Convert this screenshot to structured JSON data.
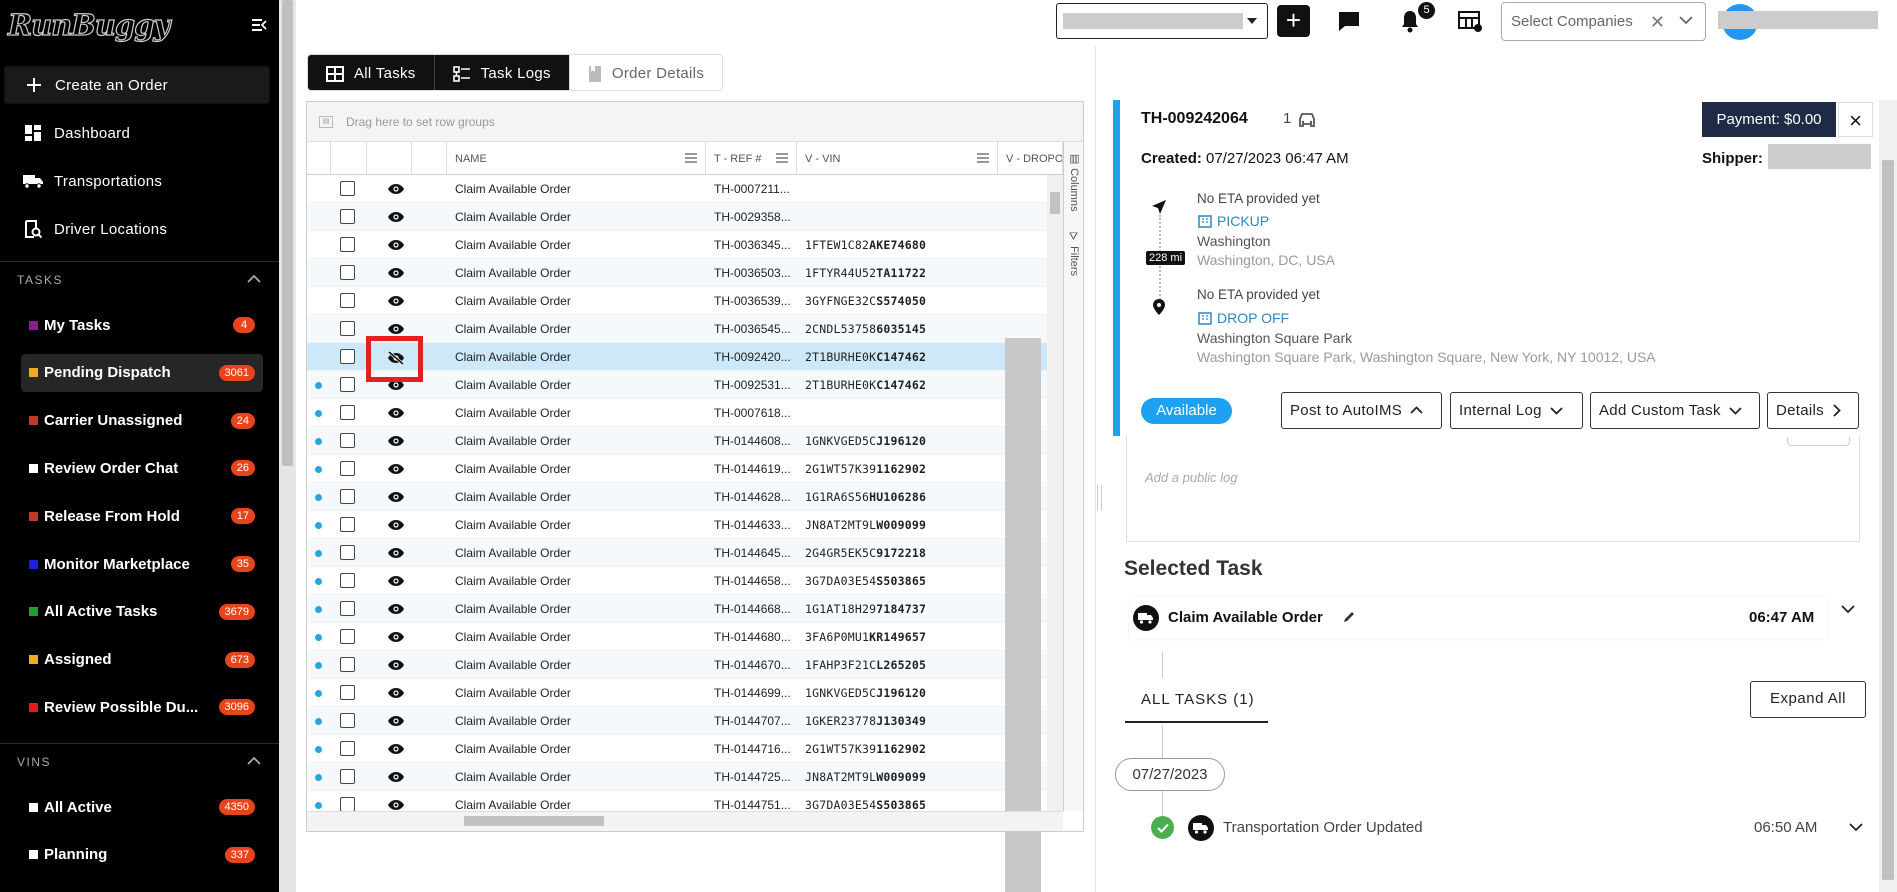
{
  "app": {
    "logo": "RunBuggy"
  },
  "sidebar": {
    "nav": [
      {
        "label": "Create an Order",
        "icon": "plus-icon"
      },
      {
        "label": "Dashboard",
        "icon": "dashboard-icon"
      },
      {
        "label": "Transportations",
        "icon": "truck-icon"
      },
      {
        "label": "Driver Locations",
        "icon": "map-search-icon"
      }
    ],
    "tasks_section": "TASKS",
    "tasks": [
      {
        "label": "My Tasks",
        "count": "4",
        "color": "#8b1e8b"
      },
      {
        "label": "Pending Dispatch",
        "count": "3061",
        "color": "#f5a623"
      },
      {
        "label": "Carrier Unassigned",
        "count": "24",
        "color": "#c0392b"
      },
      {
        "label": "Review Order Chat",
        "count": "26",
        "color": "#ffffff"
      },
      {
        "label": "Release From Hold",
        "count": "17",
        "color": "#c0392b"
      },
      {
        "label": "Monitor Marketplace",
        "count": "35",
        "color": "#1f1fd6"
      },
      {
        "label": "All Active Tasks",
        "count": "3679",
        "color": "#1f9e3a"
      },
      {
        "label": "Assigned",
        "count": "673",
        "color": "#f5a623"
      },
      {
        "label": "Review Possible Du...",
        "count": "3096",
        "color": "#e01b1b"
      }
    ],
    "vins_section": "VINS",
    "vins": [
      {
        "label": "All Active",
        "count": "4350",
        "color": "#ffffff"
      },
      {
        "label": "Planning",
        "count": "337",
        "color": "#ffffff"
      }
    ]
  },
  "topbar": {
    "notifications_count": "5",
    "company_placeholder": "Select Companies"
  },
  "tabs": [
    {
      "label": "All Tasks"
    },
    {
      "label": "Task Logs"
    },
    {
      "label": "Order Details"
    }
  ],
  "grid": {
    "group_placeholder": "Drag here to set row groups",
    "columns": [
      "NAME",
      "T - REF #",
      "V - VIN",
      "V - DROPOFF"
    ],
    "side_labels": [
      "Columns",
      "Filters"
    ],
    "rows": [
      {
        "name": "Claim Available Order",
        "ref": "TH-0007211...",
        "vin_a": "",
        "vin_b": "",
        "dot": false
      },
      {
        "name": "Claim Available Order",
        "ref": "TH-0029358...",
        "vin_a": "",
        "vin_b": "",
        "dot": false
      },
      {
        "name": "Claim Available Order",
        "ref": "TH-0036345...",
        "vin_a": "1FTEW1C82",
        "vin_b": "AKE74680",
        "dot": false
      },
      {
        "name": "Claim Available Order",
        "ref": "TH-0036503...",
        "vin_a": "1FTYR44U52",
        "vin_b": "TA11722",
        "dot": false
      },
      {
        "name": "Claim Available Order",
        "ref": "TH-0036539...",
        "vin_a": "3GYFNGE32C",
        "vin_b": "S574050",
        "dot": false
      },
      {
        "name": "Claim Available Order",
        "ref": "TH-0036545...",
        "vin_a": "2CNDL53758",
        "vin_b": "6035145",
        "dot": false
      },
      {
        "name": "Claim Available Order",
        "ref": "TH-0092420...",
        "vin_a": "2T1BURHE0K",
        "vin_b": "C147462",
        "dot": false
      },
      {
        "name": "Claim Available Order",
        "ref": "TH-0092531...",
        "vin_a": "2T1BURHE0K",
        "vin_b": "C147462",
        "dot": true
      },
      {
        "name": "Claim Available Order",
        "ref": "TH-0007618...",
        "vin_a": "",
        "vin_b": "",
        "dot": true
      },
      {
        "name": "Claim Available Order",
        "ref": "TH-0144608...",
        "vin_a": "1GNKVGED5C",
        "vin_b": "J196120",
        "dot": true
      },
      {
        "name": "Claim Available Order",
        "ref": "TH-0144619...",
        "vin_a": "2G1WT57K39",
        "vin_b": "1162902",
        "dot": true
      },
      {
        "name": "Claim Available Order",
        "ref": "TH-0144628...",
        "vin_a": "1G1RA6S56",
        "vin_b": "HU106286",
        "dot": true
      },
      {
        "name": "Claim Available Order",
        "ref": "TH-0144633...",
        "vin_a": "JN8AT2MT9L",
        "vin_b": "W009099",
        "dot": true
      },
      {
        "name": "Claim Available Order",
        "ref": "TH-0144645...",
        "vin_a": "2G4GR5EK5C",
        "vin_b": "9172218",
        "dot": true
      },
      {
        "name": "Claim Available Order",
        "ref": "TH-0144658...",
        "vin_a": "3G7DA03E54",
        "vin_b": "S503865",
        "dot": true
      },
      {
        "name": "Claim Available Order",
        "ref": "TH-0144668...",
        "vin_a": "1G1AT18H29",
        "vin_b": "7184737",
        "dot": true
      },
      {
        "name": "Claim Available Order",
        "ref": "TH-0144680...",
        "vin_a": "3FA6P0MU1",
        "vin_b": "KR149657",
        "dot": true
      },
      {
        "name": "Claim Available Order",
        "ref": "TH-0144670...",
        "vin_a": "1FAHP3F21C",
        "vin_b": "L265205",
        "dot": true
      },
      {
        "name": "Claim Available Order",
        "ref": "TH-0144699...",
        "vin_a": "1GNKVGED5C",
        "vin_b": "J196120",
        "dot": true
      },
      {
        "name": "Claim Available Order",
        "ref": "TH-0144707...",
        "vin_a": "1GKER23778",
        "vin_b": "J130349",
        "dot": true
      },
      {
        "name": "Claim Available Order",
        "ref": "TH-0144716...",
        "vin_a": "2G1WT57K39",
        "vin_b": "1162902",
        "dot": true
      },
      {
        "name": "Claim Available Order",
        "ref": "TH-0144725...",
        "vin_a": "JN8AT2MT9L",
        "vin_b": "W009099",
        "dot": true
      },
      {
        "name": "Claim Available Order",
        "ref": "TH-0144751...",
        "vin_a": "3G7DA03E54",
        "vin_b": "S503865",
        "dot": true
      }
    ]
  },
  "detail": {
    "order_id": "TH-009242064",
    "vehicle_count": "1",
    "payment": "Payment: $0.00",
    "created_label": "Created:",
    "created_value": "07/27/2023 06:47 AM",
    "shipper_label": "Shipper:",
    "miles": "228 mi",
    "pickup": {
      "eta": "No ETA provided yet",
      "label": "PICKUP",
      "name": "Washington",
      "address": "Washington, DC, USA"
    },
    "dropoff": {
      "eta": "No ETA provided yet",
      "label": "DROP OFF",
      "name": "Washington Square Park",
      "address": "Washington Square Park, Washington Square, New York, NY 10012, USA"
    },
    "status": "Available",
    "actions": [
      "Post to AutoIMS",
      "Internal Log",
      "Add Custom Task",
      "Details"
    ],
    "log_placeholder": "Add a public log"
  },
  "selected_task": {
    "heading": "Selected Task",
    "name": "Claim Available Order",
    "time": "06:47 AM"
  },
  "all_tasks": {
    "tab": "ALL TASKS (1)",
    "expand": "Expand All",
    "date": "07/27/2023",
    "event": "Transportation Order Updated",
    "event_time": "06:50 AM"
  }
}
